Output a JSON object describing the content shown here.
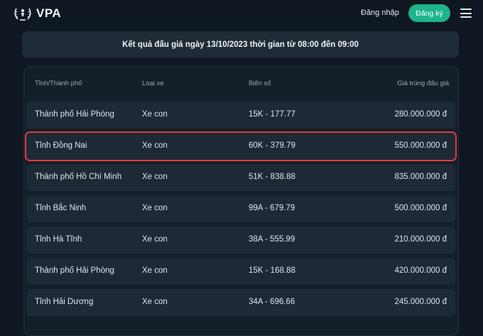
{
  "header": {
    "logo_text": "VPA",
    "login_label": "Đăng nhập",
    "register_label": "Đăng ký"
  },
  "banner": {
    "text": "Kết quả đấu giá ngày 13/10/2023 thời gian từ 08:00 đến 09:00"
  },
  "table": {
    "columns": [
      "Tỉnh/Thành phố",
      "Loại xe",
      "Biển số",
      "Giá trúng đấu giá"
    ],
    "rows": [
      [
        "Thành phố Hải Phòng",
        "Xe con",
        "15K - 177.77",
        "280.000.000 đ"
      ],
      [
        "Tỉnh Đồng Nai",
        "Xe con",
        "60K - 379.79",
        "550.000.000 đ"
      ],
      [
        "Thành phố Hồ Chí Minh",
        "Xe con",
        "51K - 838.88",
        "835.000.000 đ"
      ],
      [
        "Tỉnh Bắc Ninh",
        "Xe con",
        "99A - 679.79",
        "500.000.000 đ"
      ],
      [
        "Tỉnh Hà Tĩnh",
        "Xe con",
        "38A - 555.99",
        "210.000.000 đ"
      ],
      [
        "Thành phố Hải Phòng",
        "Xe con",
        "15K - 168.88",
        "420.000.000 đ"
      ],
      [
        "Tỉnh Hải Dương",
        "Xe con",
        "34A - 696.66",
        "245.000.000 đ"
      ]
    ],
    "highlighted_row": 1,
    "highlight_color": "#e23c3c"
  },
  "colors": {
    "background": "#0f1822",
    "accent": "#1fb48a"
  },
  "icons": {
    "logo": "laurel-badge-icon",
    "menu": "hamburger-menu-icon"
  }
}
